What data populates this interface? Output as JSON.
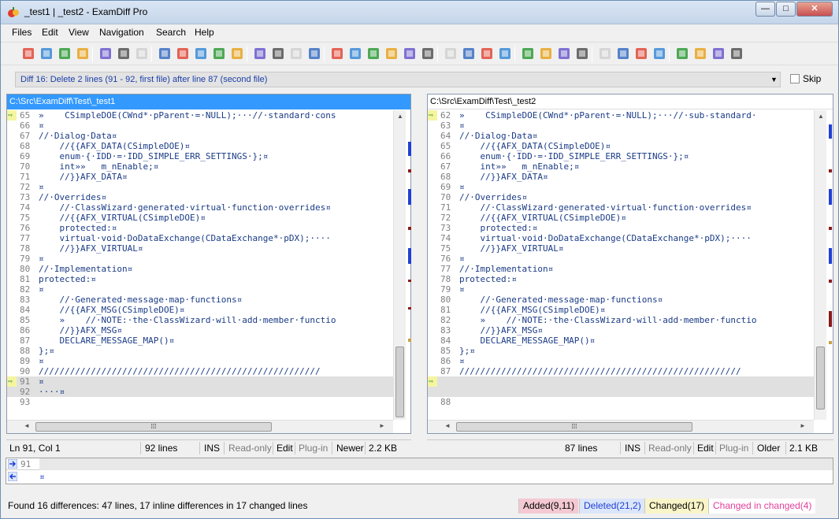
{
  "window": {
    "title": "_test1  |  _test2 - ExamDiff Pro",
    "minimize": "—",
    "maximize": "□",
    "close": "✕"
  },
  "menu": [
    "Files",
    "Edit",
    "View",
    "Navigation",
    "Search",
    "Help"
  ],
  "toolbar_icons": [
    "open-icon",
    "reopen-icon",
    "swap-icon",
    "folder-icon",
    "save-left-icon",
    "save-right-icon",
    "save-all-icon",
    "edit-left-icon",
    "edit-right-icon",
    "highlight-icon",
    "print-icon",
    "print-preview-icon",
    "undo-icon",
    "redo-icon",
    "next-arrow-icon",
    "prev-arrow-icon",
    "horizontal-layout-icon",
    "single-pane-icon",
    "vertical-split-icon",
    "side-by-side-icon",
    "show-diffs-icon",
    "filter-icon",
    "sync-scroll-icon",
    "first-diff-icon",
    "current-diff-icon",
    "last-diff-icon",
    "find-icon",
    "find-next-icon",
    "replace-icon",
    "options-icon",
    "word-wrap-icon",
    "plugins-icon",
    "settings-icon",
    "compare-icon",
    "report-icon",
    "export-icon",
    "merge-icon",
    "copy-to-right-icon"
  ],
  "diffbar": {
    "text": "Diff 16: Delete 2 lines (91 - 92, first file) after line 87 (second file)",
    "skip_label": "Skip",
    "dropdown": "▼"
  },
  "left_pane": {
    "path": "C:\\Src\\ExamDiff\\Test\\_test1",
    "lines": [
      {
        "n": "65",
        "t": "»    CSimpleDOE(CWnd*·pParent·=·NULL);···//·standard·cons",
        "gutter": "arrow"
      },
      {
        "n": "66",
        "t": "¤"
      },
      {
        "n": "67",
        "t": "//·Dialog·Data¤"
      },
      {
        "n": "68",
        "t": "    //{{AFX_DATA(CSimpleDOE)¤"
      },
      {
        "n": "69",
        "t": "    enum·{·IDD·=·IDD_SIMPLE_ERR_SETTINGS·};¤"
      },
      {
        "n": "70",
        "t": "    int»»   m_nEnable;¤"
      },
      {
        "n": "71",
        "t": "    //}}AFX_DATA¤"
      },
      {
        "n": "72",
        "t": "¤"
      },
      {
        "n": "73",
        "t": "//·Overrides¤"
      },
      {
        "n": "74",
        "t": "    //·ClassWizard·generated·virtual·function·overrides¤"
      },
      {
        "n": "75",
        "t": "    //{{AFX_VIRTUAL(CSimpleDOE)¤"
      },
      {
        "n": "76",
        "t": "    protected:¤"
      },
      {
        "n": "77",
        "t": "    virtual·void·DoDataExchange(CDataExchange*·pDX);····"
      },
      {
        "n": "78",
        "t": "    //}}AFX_VIRTUAL¤"
      },
      {
        "n": "79",
        "t": "¤"
      },
      {
        "n": "80",
        "t": "//·Implementation¤"
      },
      {
        "n": "81",
        "t": "protected:¤"
      },
      {
        "n": "82",
        "t": "¤"
      },
      {
        "n": "83",
        "t": "    //·Generated·message·map·functions¤"
      },
      {
        "n": "84",
        "t": "    //{{AFX_MSG(CSimpleDOE)¤"
      },
      {
        "n": "85",
        "t": "    »    //·NOTE:·the·ClassWizard·will·add·member·functio"
      },
      {
        "n": "86",
        "t": "    //}}AFX_MSG¤"
      },
      {
        "n": "87",
        "t": "    DECLARE_MESSAGE_MAP()¤"
      },
      {
        "n": "88",
        "t": "};¤"
      },
      {
        "n": "89",
        "t": "¤"
      },
      {
        "n": "90",
        "t": "//////////////////////////////////////////////////////"
      },
      {
        "n": "91",
        "t": "¤",
        "gutter": "arrow",
        "hl": true
      },
      {
        "n": "92",
        "t": "····¤",
        "hl": true
      },
      {
        "n": "93",
        "t": ""
      }
    ],
    "status": {
      "pos": "Ln 91, Col 1",
      "lines": "92 lines",
      "ins": "INS",
      "ro": "Read-only",
      "edit": "Edit",
      "plugin": "Plug-in",
      "age": "Newer",
      "size": "2.2 KB"
    }
  },
  "right_pane": {
    "path": "C:\\Src\\ExamDiff\\Test\\_test2",
    "lines": [
      {
        "n": "62",
        "t": "»    CSimpleDOE(CWnd*·pParent·=·NULL);···//·sub-standard·",
        "gutter": "arrow"
      },
      {
        "n": "63",
        "t": "¤"
      },
      {
        "n": "64",
        "t": "//·Dialog·Data¤"
      },
      {
        "n": "65",
        "t": "    //{{AFX_DATA(CSimpleDOE)¤"
      },
      {
        "n": "66",
        "t": "    enum·{·IDD·=·IDD_SIMPLE_ERR_SETTINGS·};¤"
      },
      {
        "n": "67",
        "t": "    int»»   m_nEnable;¤"
      },
      {
        "n": "68",
        "t": "    //}}AFX_DATA¤"
      },
      {
        "n": "69",
        "t": "¤"
      },
      {
        "n": "70",
        "t": "//·Overrides¤"
      },
      {
        "n": "71",
        "t": "    //·ClassWizard·generated·virtual·function·overrides¤"
      },
      {
        "n": "72",
        "t": "    //{{AFX_VIRTUAL(CSimpleDOE)¤"
      },
      {
        "n": "73",
        "t": "    protected:¤"
      },
      {
        "n": "74",
        "t": "    virtual·void·DoDataExchange(CDataExchange*·pDX);····"
      },
      {
        "n": "75",
        "t": "    //}}AFX_VIRTUAL¤"
      },
      {
        "n": "76",
        "t": "¤"
      },
      {
        "n": "77",
        "t": "//·Implementation¤"
      },
      {
        "n": "78",
        "t": "protected:¤"
      },
      {
        "n": "79",
        "t": "¤"
      },
      {
        "n": "80",
        "t": "    //·Generated·message·map·functions¤"
      },
      {
        "n": "81",
        "t": "    //{{AFX_MSG(CSimpleDOE)¤"
      },
      {
        "n": "82",
        "t": "    »    //·NOTE:·the·ClassWizard·will·add·member·functio"
      },
      {
        "n": "83",
        "t": "    //}}AFX_MSG¤"
      },
      {
        "n": "84",
        "t": "    DECLARE_MESSAGE_MAP()¤"
      },
      {
        "n": "85",
        "t": "};¤"
      },
      {
        "n": "86",
        "t": "¤"
      },
      {
        "n": "87",
        "t": "//////////////////////////////////////////////////////"
      },
      {
        "n": "",
        "t": "",
        "gutter": "arrow",
        "hl": true
      },
      {
        "n": "",
        "t": "",
        "hl": true
      },
      {
        "n": "88",
        "t": ""
      }
    ],
    "status": {
      "lines": "87 lines",
      "ins": "INS",
      "ro": "Read-only",
      "edit": "Edit",
      "plugin": "Plug-in",
      "age": "Older",
      "size": "2.1 KB"
    }
  },
  "compare_lines": [
    {
      "n": "91",
      "t": ""
    },
    {
      "n": "",
      "t": "¤"
    }
  ],
  "bottom": {
    "summary": "Found 16 differences: 47 lines, 17 inline differences in 17 changed lines",
    "added": "Added(9,11)",
    "deleted": "Deleted(21,2)",
    "changed": "Changed(17)",
    "changed_in_changed": "Changed in changed(4)"
  },
  "colors": {
    "added_bg": "#f4c9d3",
    "deleted_bg": "#dbe6fb",
    "changed_bg": "#f9f5c8",
    "changed_in_changed_fg": "#e0409a",
    "deleted_fg": "#1f3fd6",
    "active_path_bg": "#3399ff"
  }
}
